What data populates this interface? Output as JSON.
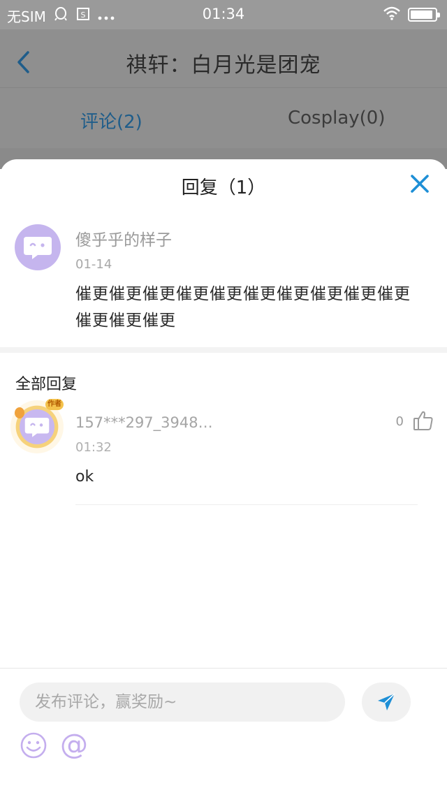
{
  "status_bar": {
    "carrier": "无SIM",
    "time": "01:34",
    "battery_level": 0.9
  },
  "background_page": {
    "title": "祺轩：白月光是团宠",
    "tabs": [
      {
        "label": "评论(2)",
        "active": true
      },
      {
        "label": "Cosplay(0)",
        "active": false
      }
    ]
  },
  "reply_sheet": {
    "title": "回复（1）",
    "parent_comment": {
      "author": "傻乎乎的样子",
      "date": "01-14",
      "text": "催更催更催更催更催更催更催更催更催更催更催更催更催更"
    },
    "all_replies_label": "全部回复",
    "replies": [
      {
        "author": "157***297_3948…",
        "date": "01:32",
        "text": "ok",
        "likes": "0",
        "frame_badge": "作者"
      }
    ]
  },
  "composer": {
    "placeholder": "发布评论，赢奖励~",
    "at_symbol": "@"
  },
  "colors": {
    "accent_blue": "#1e8fd6",
    "avatar_purple": "#c5b5ee",
    "emoji_purple": "#c4aeee"
  },
  "icons": [
    "back-icon",
    "qq-icon",
    "screenshot-icon",
    "more-icon",
    "wifi-icon",
    "battery-icon",
    "close-icon",
    "chat-bubble-icon",
    "thumbs-up-icon",
    "send-icon",
    "emoji-icon",
    "at-icon"
  ]
}
